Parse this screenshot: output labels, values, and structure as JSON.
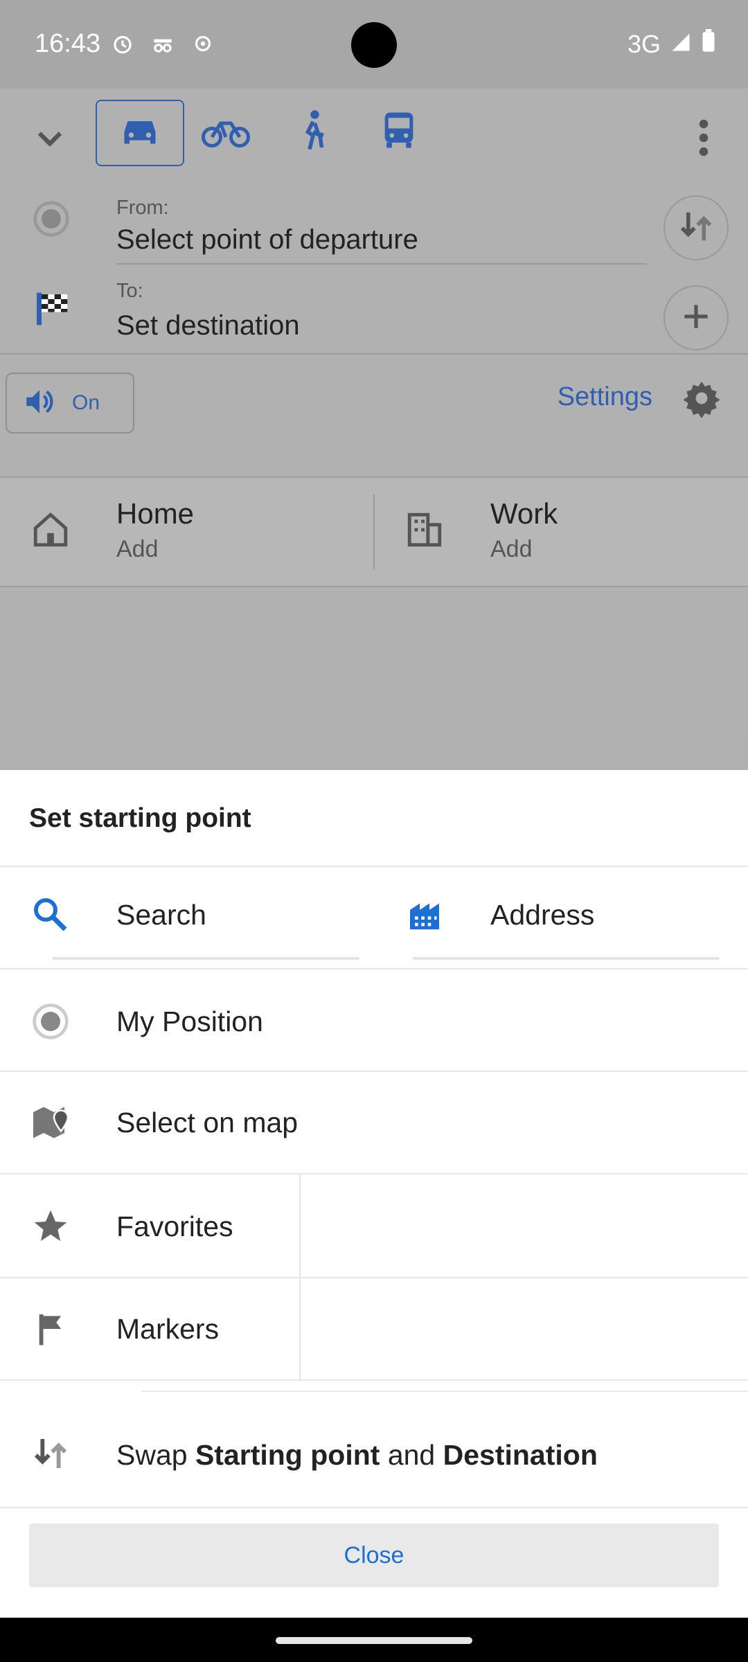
{
  "status_bar": {
    "time": "16:43",
    "network": "3G"
  },
  "route": {
    "from_label": "From:",
    "from_value": "Select point of departure",
    "to_label": "To:",
    "to_value": "Set destination",
    "sound_label": "On",
    "settings_label": "Settings"
  },
  "places": {
    "home_title": "Home",
    "home_sub": "Add",
    "work_title": "Work",
    "work_sub": "Add"
  },
  "sheet": {
    "title": "Set starting point",
    "search": "Search",
    "address": "Address",
    "my_position": "My Position",
    "select_on_map": "Select on map",
    "favorites": "Favorites",
    "markers": "Markers",
    "swap_prefix": "Swap ",
    "swap_bold1": "Starting point",
    "swap_mid": " and ",
    "swap_bold2": "Destination",
    "close": "Close"
  },
  "colors": {
    "accent": "#2f5fae",
    "link_blue": "#1b6fd6",
    "icon_grey": "#666666"
  }
}
